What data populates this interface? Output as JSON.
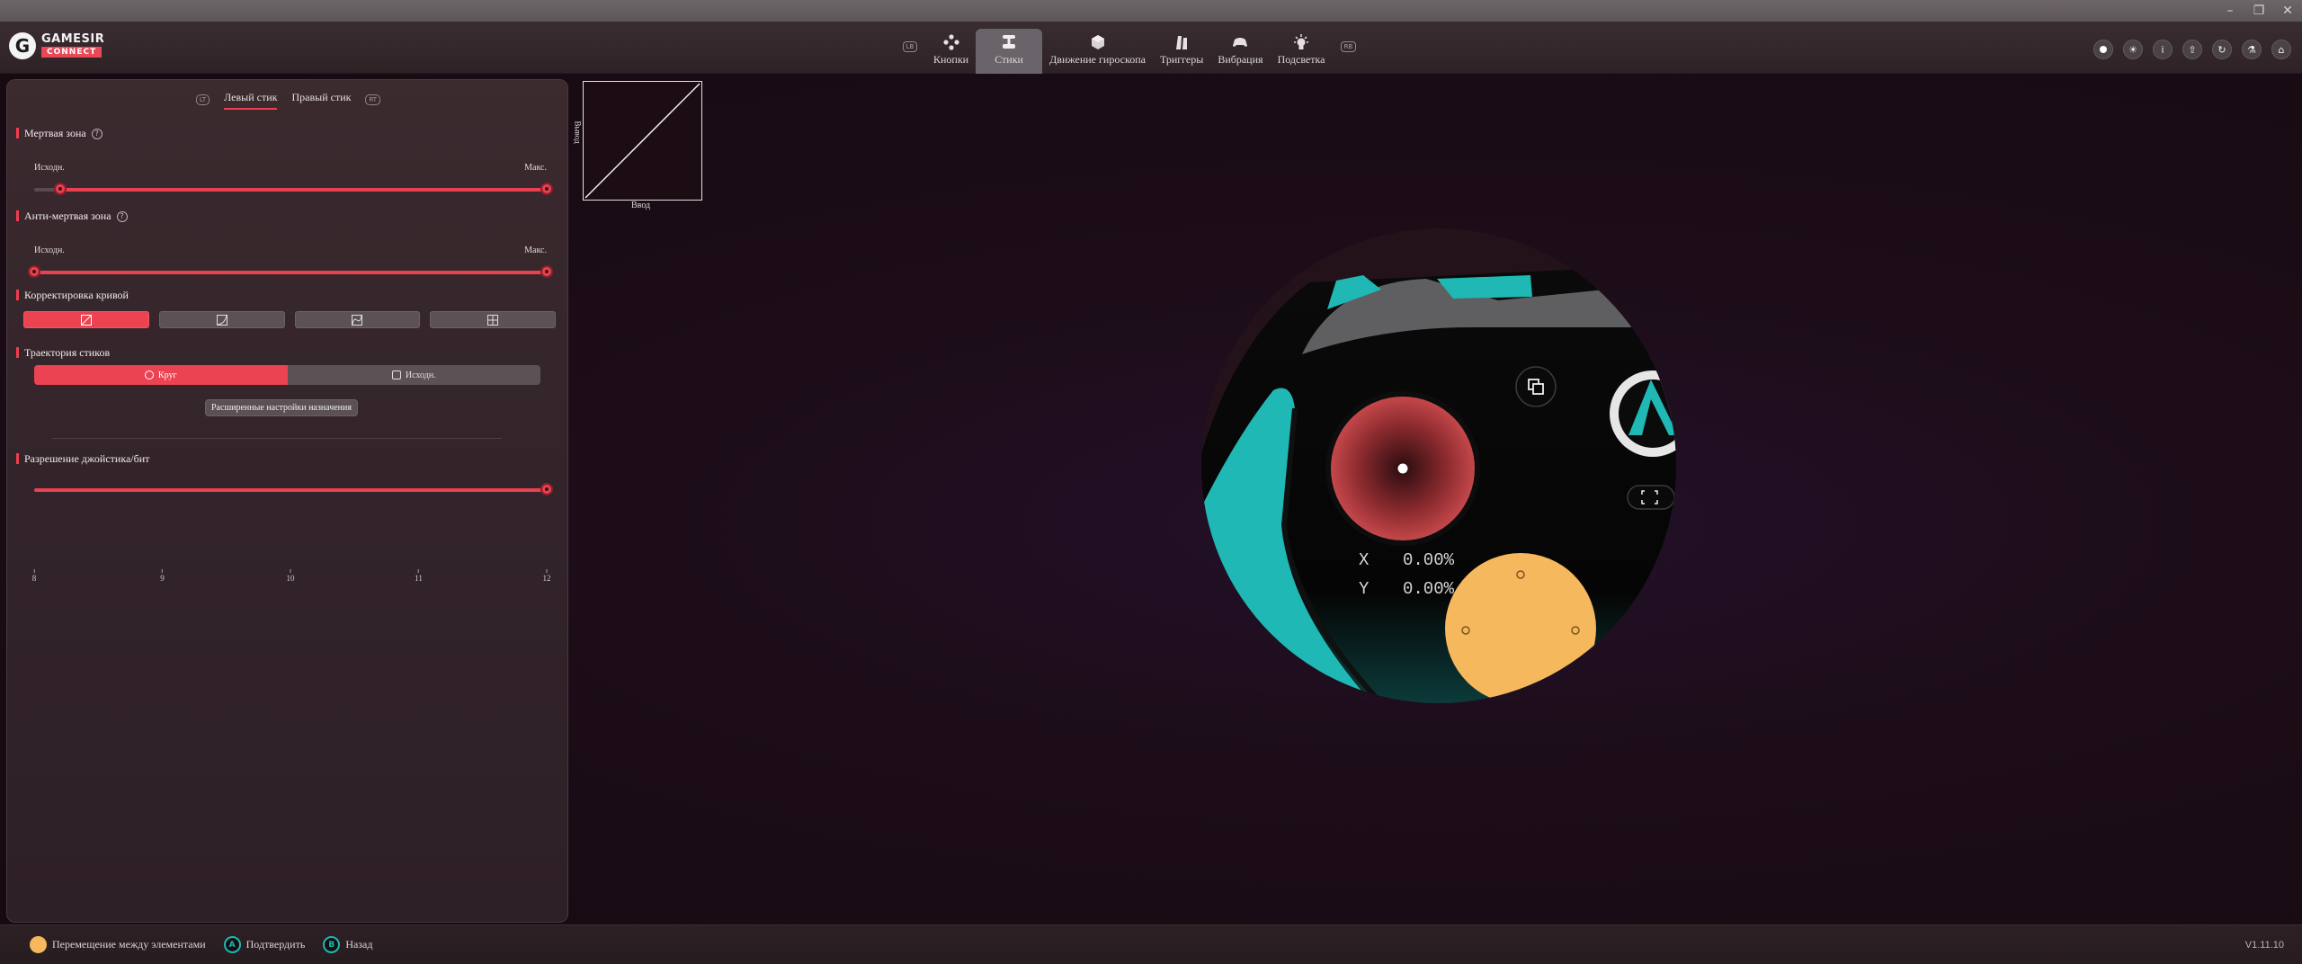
{
  "app": {
    "logo_letter": "G",
    "logo_line1": "GAMESIR",
    "logo_line2": "CONNECT",
    "version": "V1.11.10"
  },
  "window_controls": [
    "–",
    "❐",
    "✕"
  ],
  "nav": {
    "left_badge": "LB",
    "right_badge": "RB",
    "items": [
      {
        "label": "Кнопки",
        "icon": "buttons-icon"
      },
      {
        "label": "Стики",
        "icon": "joystick-icon",
        "active": true
      },
      {
        "label": "Движение гироскопа",
        "icon": "gyro-icon"
      },
      {
        "label": "Триггеры",
        "icon": "trigger-icon"
      },
      {
        "label": "Вибрация",
        "icon": "vibration-icon"
      },
      {
        "label": "Подсветка",
        "icon": "light-icon"
      }
    ]
  },
  "toolbar_icons": [
    "record-icon",
    "brightness-icon",
    "info-icon",
    "upload-icon",
    "refresh-icon",
    "lab-icon",
    "home-icon"
  ],
  "panel": {
    "tab_left_badge": "LT",
    "tab_right_badge": "RT",
    "tabs": [
      "Левый стик",
      "Правый стик"
    ],
    "deadzone": {
      "title": "Мертвая зона",
      "min_label": "Исходн.",
      "max_label": "Макс.",
      "value_start_fraction": 0.05,
      "value_end_fraction": 1.0
    },
    "anti_deadzone": {
      "title": "Анти-мертвая зона",
      "min_label": "Исходн.",
      "max_label": "Макс.",
      "value_start_fraction": 0.0,
      "value_end_fraction": 1.0
    },
    "curve": {
      "title": "Корректировка кривой",
      "options": [
        "linear-curve-icon",
        "exponential-curve-icon",
        "s-curve-icon",
        "custom-curve-icon"
      ],
      "selected": 0
    },
    "trajectory": {
      "title": "Траектория стиков",
      "options": [
        "Круг",
        "Исходн."
      ],
      "selected": 0
    },
    "advanced_button": "Расширенные настройки назначения",
    "resolution": {
      "title": "Разрешение джойстика/бит",
      "ticks": [
        "8",
        "9",
        "10",
        "11",
        "12"
      ],
      "value": 12
    }
  },
  "graph": {
    "ylabel": "Вывод",
    "xlabel": "Ввод"
  },
  "stick_readout": {
    "x_label": "X",
    "x_value": "0.00%",
    "y_label": "Y",
    "y_value": "0.00%"
  },
  "colors": {
    "accent": "#ec4352",
    "teal": "#1fb8b4",
    "yellow": "#f5b85c"
  },
  "footer": {
    "hints": [
      {
        "label": "Перемещение между элементами",
        "icon": "left-stick-icon"
      },
      {
        "label": "Подтвердить",
        "icon": "a-button-icon"
      },
      {
        "label": "Назад",
        "icon": "b-button-icon"
      }
    ]
  }
}
